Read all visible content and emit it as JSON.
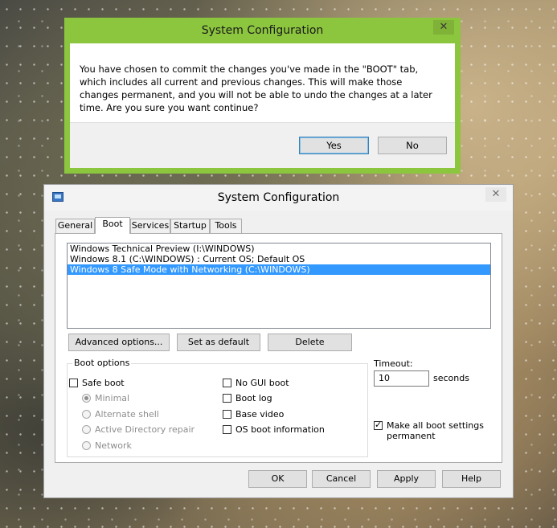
{
  "confirm_dialog": {
    "title": "System Configuration",
    "close_glyph": "✕",
    "message": "You have chosen to commit the changes you've made in the \"BOOT\" tab, which includes all current and previous changes. This will make those changes permanent, and you will not be able to undo the changes at a later time. Are you sure you want continue?",
    "yes_label": "Yes",
    "no_label": "No",
    "accent_color": "#8cc63f"
  },
  "main_window": {
    "title": "System Configuration",
    "close_glyph": "✕",
    "tabs": [
      {
        "label": "General"
      },
      {
        "label": "Boot"
      },
      {
        "label": "Services"
      },
      {
        "label": "Startup"
      },
      {
        "label": "Tools"
      }
    ],
    "active_tab": "Boot",
    "os_list": [
      {
        "label": "Windows Technical Preview (I:\\WINDOWS)",
        "selected": false
      },
      {
        "label": "Windows 8.1 (C:\\WINDOWS) : Current OS; Default OS",
        "selected": false
      },
      {
        "label": "Windows 8 Safe Mode with Networking (C:\\WINDOWS)",
        "selected": true
      }
    ],
    "buttons": {
      "advanced": "Advanced options...",
      "set_default": "Set as default",
      "delete": "Delete"
    },
    "boot_options": {
      "title": "Boot options",
      "safe_boot": {
        "label": "Safe boot",
        "checked": false
      },
      "radios": [
        {
          "label": "Minimal",
          "checked": true
        },
        {
          "label": "Alternate shell",
          "checked": false
        },
        {
          "label": "Active Directory repair",
          "checked": false
        },
        {
          "label": "Network",
          "checked": false
        }
      ],
      "right_checks": [
        {
          "label": "No GUI boot",
          "checked": false
        },
        {
          "label": "Boot log",
          "checked": false
        },
        {
          "label": "Base video",
          "checked": false
        },
        {
          "label": "OS boot information",
          "checked": false
        }
      ]
    },
    "timeout": {
      "label": "Timeout:",
      "value": "10",
      "unit": "seconds"
    },
    "make_permanent": {
      "label": "Make all boot settings permanent",
      "checked": true
    },
    "footer": {
      "ok": "OK",
      "cancel": "Cancel",
      "apply": "Apply",
      "help": "Help"
    },
    "selection_color": "#3399ff"
  }
}
